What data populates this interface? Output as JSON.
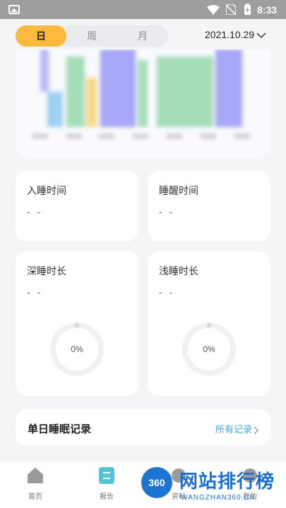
{
  "status_bar": {
    "time": "8:33"
  },
  "period_tabs": {
    "day": "日",
    "week": "周",
    "month": "月",
    "active": "day"
  },
  "date": "2021.10.29",
  "colors": {
    "accent": "#fbb93d",
    "link": "#3fa8d6",
    "deep_sleep": "#a7a6f7",
    "light_sleep": "#a6ddb9",
    "awake": "#f7d98c",
    "rem": "#9fd0f3"
  },
  "stats": {
    "sleep_time": {
      "label": "入睡时间",
      "value": "- -"
    },
    "wake_time": {
      "label": "睡醒时间",
      "value": "- -"
    },
    "deep_sleep": {
      "label": "深睡时长",
      "value": "- -",
      "percent": "0%"
    },
    "light_sleep": {
      "label": "浅睡时长",
      "value": "- -",
      "percent": "0%"
    }
  },
  "record": {
    "title": "单日睡眠记录",
    "link": "所有记录"
  },
  "nav": [
    {
      "label": "首页",
      "icon": "home-icon"
    },
    {
      "label": "报告",
      "icon": "report-icon"
    },
    {
      "label": "资料",
      "icon": "info-icon"
    },
    {
      "label": "我的",
      "icon": "profile-icon"
    }
  ],
  "watermark": {
    "badge": "360",
    "title": "网站排行榜",
    "url": "WANGZHAN360.CN"
  }
}
